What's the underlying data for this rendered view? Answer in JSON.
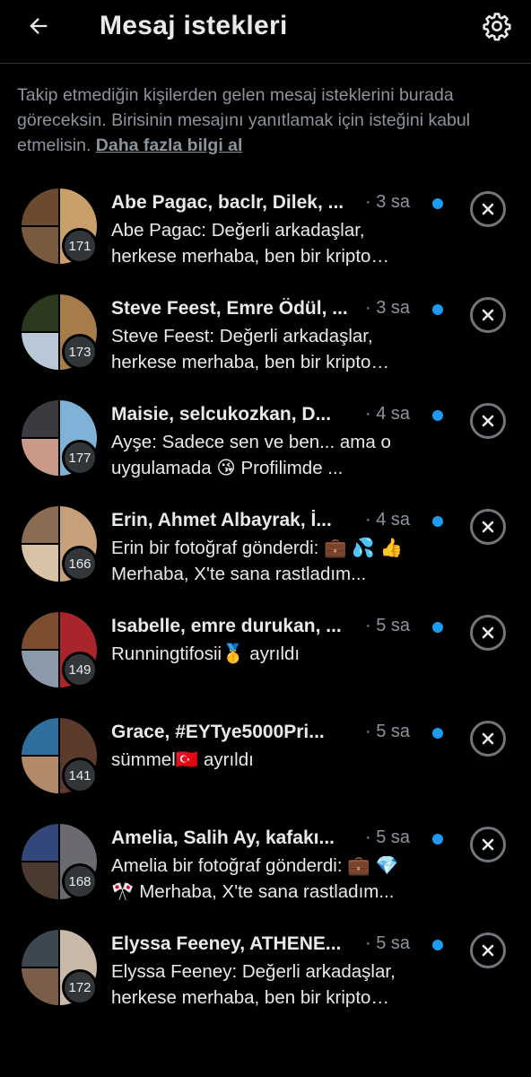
{
  "header": {
    "title": "Mesaj istekleri",
    "back_icon": "arrow-left-icon",
    "settings_icon": "gear-icon"
  },
  "info": {
    "text": "Takip etmediğin kişilerden gelen mesaj isteklerini burada göreceksin. Birisinin mesajını yanıtlamak için isteğini kabul etmelisin.",
    "link": "Daha fazla bilgi al"
  },
  "colors": {
    "background": "#000000",
    "unread_dot": "#1d9bf0",
    "muted": "#8b949c"
  },
  "requests": [
    {
      "name": "Abe Pagac, baclr, Dilek, ...",
      "time": "· 3 sa",
      "count": "171",
      "message": "Abe Pagac: Değerli arkadaşlar, herkese merhaba, ben bir kripto analistiyim...",
      "unread": true
    },
    {
      "name": "Steve Feest, Emre Ödül, ...",
      "time": "· 3 sa",
      "count": "173",
      "message": "Steve Feest: Değerli arkadaşlar, herkese merhaba, ben bir kripto analistiyim...",
      "unread": true
    },
    {
      "name": "Maisie, selcukozkan, D...",
      "time": "· 4 sa",
      "count": "177",
      "message": "Ayşe: Sadece sen ve ben... ama o uygulamada 😘 Profilimde ...",
      "unread": true
    },
    {
      "name": "Erin, Ahmet Albayrak, İ...",
      "time": "· 4 sa",
      "count": "166",
      "message": "Erin bir fotoğraf gönderdi: 💼 💦 👍 Merhaba, X'te sana rastladım...",
      "unread": true
    },
    {
      "name": "Isabelle, emre durukan, ...",
      "time": "· 5 sa",
      "count": "149",
      "message": "Runningtifosii🥇 ayrıldı",
      "unread": true
    },
    {
      "name": "Grace, #EYTye5000Pri...",
      "time": "· 5 sa",
      "count": "141",
      "message": "sümmel🇹🇷 ayrıldı",
      "unread": true
    },
    {
      "name": "Amelia, Salih Ay, kafakı...",
      "time": "· 5 sa",
      "count": "168",
      "message": "Amelia bir fotoğraf gönderdi: 💼 💎 🎌 Merhaba, X'te sana rastladım...",
      "unread": true
    },
    {
      "name": "Elyssa Feeney, ATHENE...",
      "time": "· 5 sa",
      "count": "172",
      "message": "Elyssa Feeney: Değerli arkadaşlar, herkese merhaba, ben bir kripto analistiyim...",
      "unread": true
    }
  ]
}
